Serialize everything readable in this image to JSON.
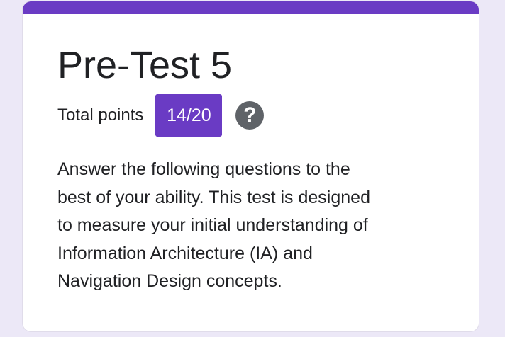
{
  "form": {
    "title": "Pre-Test 5",
    "points_label": "Total points",
    "score": "14/20",
    "help_icon": "help-circle-icon",
    "description": " Answer the following questions to the\nbest of your ability. This test is designed\nto measure your initial understanding of\nInformation Architecture (IA) and\nNavigation Design concepts."
  },
  "colors": {
    "accent": "#6a3bc4",
    "background": "#ece8f7",
    "card": "#ffffff",
    "text": "#202124",
    "help_icon": "#5f6368"
  }
}
